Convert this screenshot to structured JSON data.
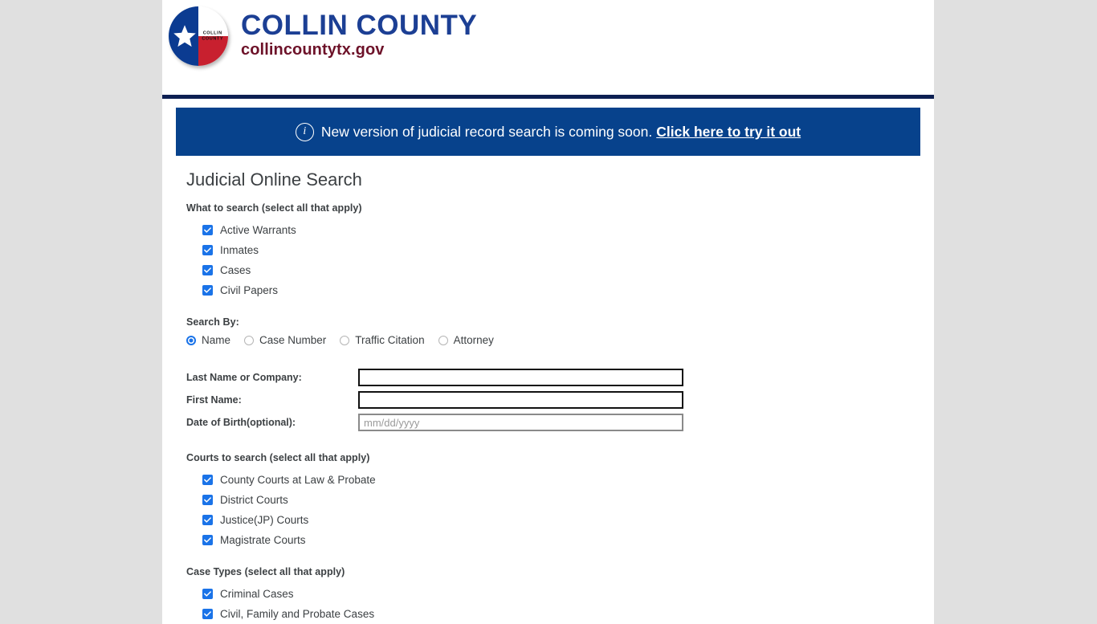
{
  "header": {
    "seal_text_line1": "COLLIN",
    "seal_text_line2": "COUNTY",
    "title": "COLLIN COUNTY",
    "subtitle": "collincountytx.gov"
  },
  "notice": {
    "icon": "info-icon",
    "text": "New version of judicial record search is coming soon.",
    "link_label": "Click here to try it out",
    "background_color": "#07428c"
  },
  "main": {
    "page_title": "Judicial Online Search",
    "what_to_search": {
      "label": "What to search (select all that apply)",
      "options": [
        {
          "label": "Active Warrants",
          "checked": true
        },
        {
          "label": "Inmates",
          "checked": true
        },
        {
          "label": "Cases",
          "checked": true
        },
        {
          "label": "Civil Papers",
          "checked": true
        }
      ]
    },
    "search_by": {
      "label": "Search By:",
      "options": [
        {
          "label": "Name",
          "selected": true
        },
        {
          "label": "Case Number",
          "selected": false
        },
        {
          "label": "Traffic Citation",
          "selected": false
        },
        {
          "label": "Attorney",
          "selected": false
        }
      ]
    },
    "fields": [
      {
        "label": "Last Name or Company:",
        "value": "",
        "placeholder": "",
        "style": "focus"
      },
      {
        "label": "First Name:",
        "value": "",
        "placeholder": "",
        "style": "focus"
      },
      {
        "label": "Date of Birth(optional):",
        "value": "",
        "placeholder": "mm/dd/yyyy",
        "style": "soft"
      }
    ],
    "courts": {
      "label": "Courts to search (select all that apply)",
      "options": [
        {
          "label": "County Courts at Law & Probate",
          "checked": true
        },
        {
          "label": "District Courts",
          "checked": true
        },
        {
          "label": "Justice(JP) Courts",
          "checked": true
        },
        {
          "label": "Magistrate Courts",
          "checked": true
        }
      ]
    },
    "case_types": {
      "label": "Case Types (select all that apply)",
      "options": [
        {
          "label": "Criminal Cases",
          "checked": true
        },
        {
          "label": "Civil, Family and Probate Cases",
          "checked": true
        }
      ]
    }
  },
  "colors": {
    "accent_blue": "#1a73e8",
    "navy": "#0d1f52",
    "banner_blue": "#07428c",
    "logo_navy": "#1c3f94",
    "logo_maroon": "#6d1229",
    "seal_red": "#c8202f"
  }
}
